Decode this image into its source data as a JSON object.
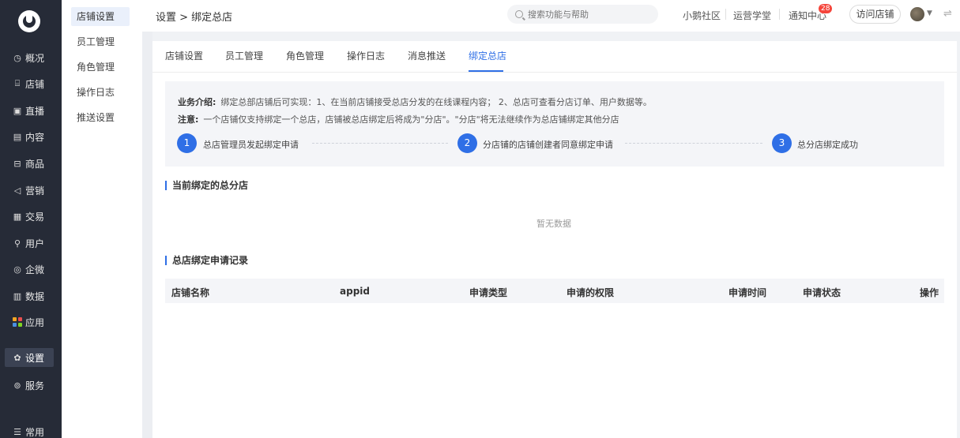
{
  "nav": {
    "items": [
      {
        "label": "概况",
        "icon": "clock-icon"
      },
      {
        "label": "店铺",
        "icon": "store-icon"
      },
      {
        "label": "直播",
        "icon": "live-icon"
      },
      {
        "label": "内容",
        "icon": "document-icon"
      },
      {
        "label": "商品",
        "icon": "goods-icon"
      },
      {
        "label": "营销",
        "icon": "megaphone-icon"
      },
      {
        "label": "交易",
        "icon": "trade-icon"
      },
      {
        "label": "用户",
        "icon": "user-icon"
      },
      {
        "label": "企微",
        "icon": "wecom-icon"
      },
      {
        "label": "数据",
        "icon": "data-icon"
      },
      {
        "label": "应用",
        "icon": "apps-icon"
      },
      {
        "label": "设置",
        "icon": "gear-icon"
      },
      {
        "label": "服务",
        "icon": "service-icon"
      },
      {
        "label": "常用",
        "icon": "menu-icon"
      }
    ],
    "active": "设置",
    "app_colors": [
      "#f5a623",
      "#e94f4f",
      "#4a90e2",
      "#7ed321"
    ]
  },
  "subnav": {
    "items": [
      "店铺设置",
      "员工管理",
      "角色管理",
      "操作日志",
      "推送设置"
    ],
    "active": "店铺设置"
  },
  "header": {
    "breadcrumb": "设置 > 绑定总店",
    "search_placeholder": "搜索功能与帮助",
    "links": [
      "小鹅社区",
      "运营学堂",
      "通知中心"
    ],
    "notify_count": "28",
    "visit_button": "访问店铺"
  },
  "tabs": [
    "店铺设置",
    "员工管理",
    "角色管理",
    "操作日志",
    "消息推送",
    "绑定总店"
  ],
  "active_tab": "绑定总店",
  "intro": {
    "biz_label": "业务介绍:",
    "biz_text": "绑定总部店铺后可实现：1、在当前店铺接受总店分发的在线课程内容； 2、总店可查看分店订单、用户数据等。",
    "note_label": "注意:",
    "note_text": "一个店铺仅支持绑定一个总店，店铺被总店绑定后将成为\"分店\"。\"分店\"将无法继续作为总店铺绑定其他分店",
    "steps": [
      {
        "num": "1",
        "text": "总店管理员发起绑定申请"
      },
      {
        "num": "2",
        "text": "分店铺的店铺创建者同意绑定申请"
      },
      {
        "num": "3",
        "text": "总分店绑定成功"
      }
    ]
  },
  "current": {
    "title": "当前绑定的总分店",
    "empty": "暂无数据"
  },
  "records": {
    "title": "总店绑定申请记录",
    "columns": [
      "店铺名称",
      "appid",
      "申请类型",
      "申请的权限",
      "申请时间",
      "申请状态",
      "操作"
    ]
  },
  "colors": {
    "accent": "#2f6fe6",
    "nav_bg": "#262b37",
    "badge": "#f5453b"
  }
}
